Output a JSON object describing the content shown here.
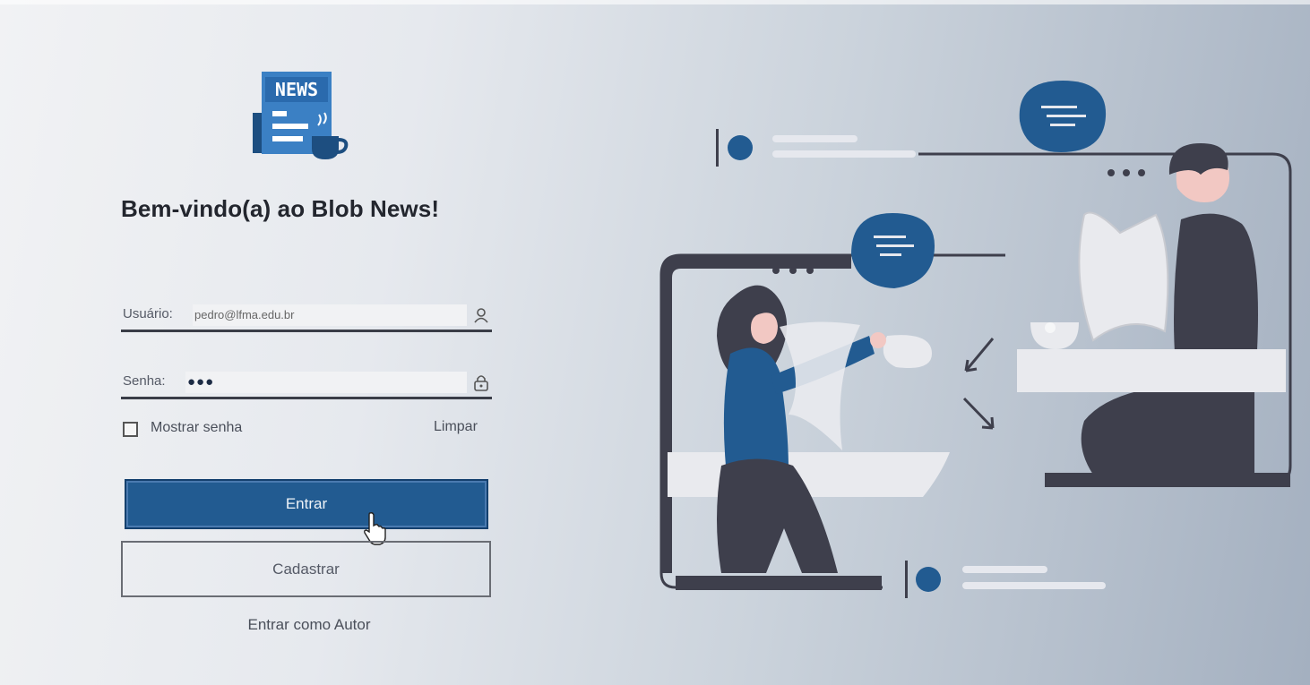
{
  "logo": {
    "text": "NEWS",
    "icon": "newspaper-coffee-icon"
  },
  "welcome_title": "Bem-vindo(a) ao Blob News!",
  "form": {
    "user_label": "Usuário:",
    "user_value": "pedro@lfma.edu.br",
    "password_label": "Senha:",
    "password_value": "●●●",
    "show_password_label": "Mostrar senha",
    "clear_label": "Limpar"
  },
  "buttons": {
    "enter": "Entrar",
    "register": "Cadastrar",
    "author_login": "Entrar como Autor"
  },
  "colors": {
    "primary": "#225b91",
    "dark": "#3e3f4c",
    "accent_blue": "#225b91"
  }
}
